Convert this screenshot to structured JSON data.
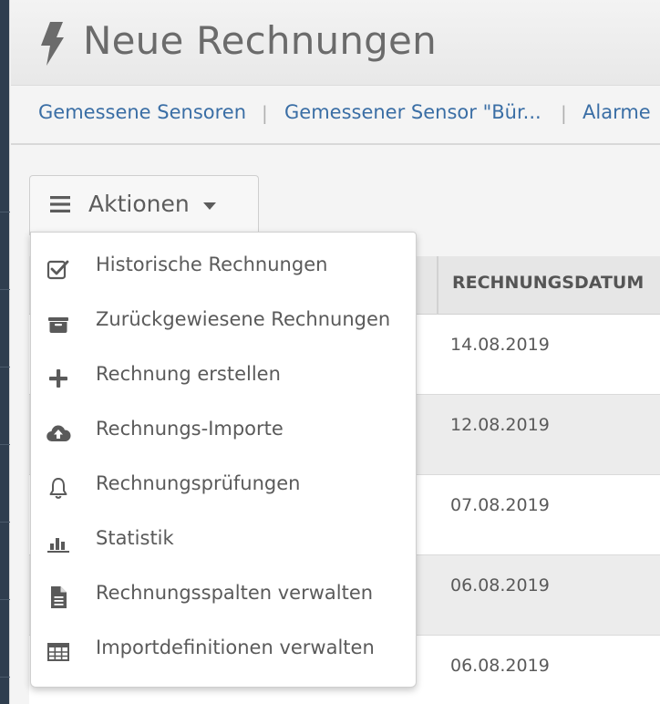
{
  "header": {
    "title": "Neue Rechnungen",
    "icon": "bolt-icon"
  },
  "breadcrumbs": [
    {
      "label": "Gemessene Sensoren"
    },
    {
      "label": "Gemessener Sensor \"Bür..."
    },
    {
      "label": "Alarme"
    }
  ],
  "breadcrumb_separator": "|",
  "actions": {
    "label": "Aktionen"
  },
  "menu": [
    {
      "label": "Historische Rechnungen",
      "icon": "checkbox-icon"
    },
    {
      "label": "Zurückgewiesene Rechnungen",
      "icon": "inbox-icon"
    },
    {
      "label": "Rechnung erstellen",
      "icon": "plus-icon"
    },
    {
      "label": "Rechnungs-Importe",
      "icon": "cloud-upload-icon"
    },
    {
      "label": "Rechnungsprüfungen",
      "icon": "bell-icon"
    },
    {
      "label": "Statistik",
      "icon": "bar-chart-icon"
    },
    {
      "label": "Rechnungsspalten verwalten",
      "icon": "document-icon"
    },
    {
      "label": "Importdefinitionen verwalten",
      "icon": "table-icon"
    }
  ],
  "table": {
    "columns": [
      "RECHNUNGSDATUM"
    ],
    "rows": [
      {
        "date": "14.08.2019"
      },
      {
        "date": "12.08.2019"
      },
      {
        "date": "07.08.2019"
      },
      {
        "date": "06.08.2019"
      },
      {
        "date": "06.08.2019"
      }
    ]
  },
  "colors": {
    "link": "#3a6ea5",
    "title": "#6b6b6b",
    "sidebar": "#2f3e4f"
  }
}
